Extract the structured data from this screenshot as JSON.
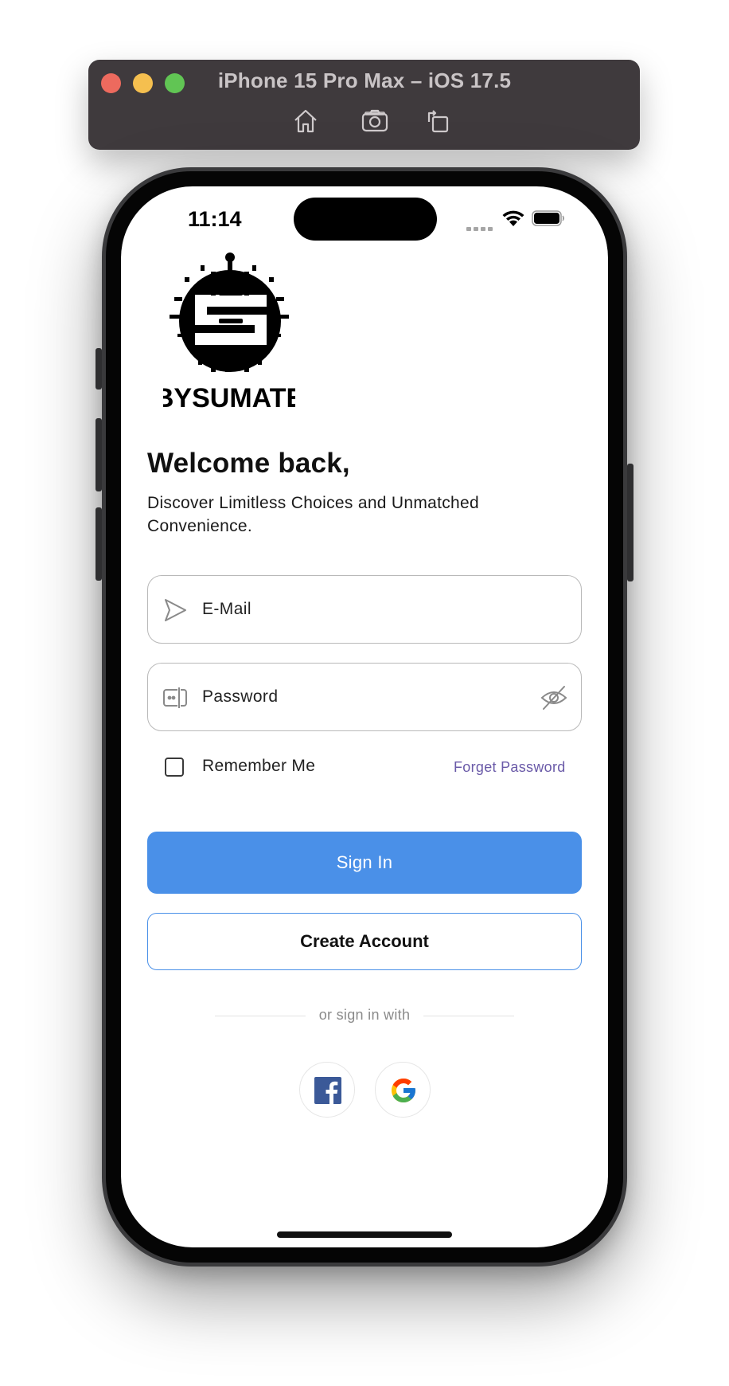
{
  "simulator": {
    "title": "iPhone 15 Pro Max – iOS 17.5",
    "toolbar_icons": [
      "home-icon",
      "screenshot-icon",
      "rotate-icon"
    ]
  },
  "status_bar": {
    "time": "11:14",
    "icons": [
      "signal-icon",
      "wifi-icon",
      "battery-icon"
    ]
  },
  "logo": {
    "text": "BYSUMATE"
  },
  "header": {
    "title": "Welcome back,",
    "subtitle": "Discover Limitless Choices and Unmatched Convenience."
  },
  "form": {
    "email": {
      "label": "E-Mail",
      "icon": "send-icon"
    },
    "password": {
      "label": "Password",
      "icon": "password-icon",
      "toggle_icon": "eye-slash-icon"
    },
    "remember_me": {
      "label": "Remember Me",
      "checked": false
    },
    "forget_password": "Forget Password"
  },
  "actions": {
    "sign_in": "Sign In",
    "create_account": "Create Account"
  },
  "social": {
    "divider_text": "or sign in with",
    "providers": [
      "facebook-icon",
      "google-icon"
    ]
  },
  "colors": {
    "primary": "#4A90E8",
    "link": "#6A5AA8",
    "facebook": "#3B5998"
  }
}
